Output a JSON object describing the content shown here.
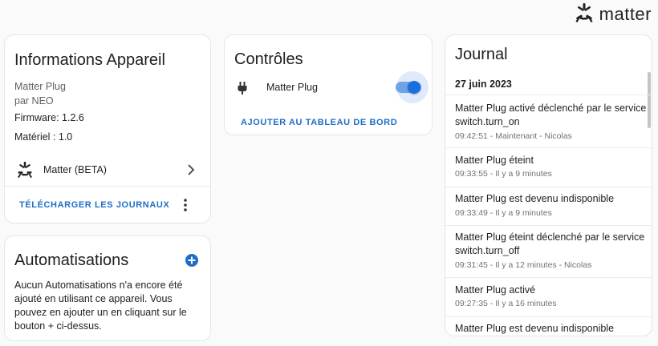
{
  "brand": {
    "name": "matter"
  },
  "info_card": {
    "title": "Informations Appareil",
    "device_name": "Matter Plug",
    "manufacturer": "par NEO",
    "firmware": "Firmware: 1.2.6",
    "hardware": "Matériel : 1.0",
    "integration_label": "Matter (BETA)",
    "download_logs": "TÉLÉCHARGER LES JOURNAUX"
  },
  "automations_card": {
    "title": "Automatisations",
    "empty_text": "Aucun Automatisations n'a encore été ajouté en utilisant ce appareil. Vous pouvez en ajouter un en cliquant sur le bouton + ci-dessus."
  },
  "controls_card": {
    "title": "Contrôles",
    "entity_name": "Matter Plug",
    "toggle_on": true,
    "add_to_dashboard": "AJOUTER AU TABLEAU DE BORD"
  },
  "journal_card": {
    "title": "Journal",
    "date": "27 juin 2023",
    "entries": [
      {
        "line1": "Matter Plug activé déclenché par le service",
        "line2": "switch.turn_on",
        "meta": "09:42:51 - Maintenant - Nicolas"
      },
      {
        "line1": "Matter Plug éteint",
        "line2": "",
        "meta": "09:33:55 - Il y a 9 minutes"
      },
      {
        "line1": "Matter Plug est devenu indisponible",
        "line2": "",
        "meta": "09:33:49 - Il y a 9 minutes"
      },
      {
        "line1": "Matter Plug éteint déclenché par le service",
        "line2": "switch.turn_off",
        "meta": "09:31:45 - Il y a 12 minutes - Nicolas"
      },
      {
        "line1": "Matter Plug activé",
        "line2": "",
        "meta": "09:27:35 - Il y a 16 minutes"
      },
      {
        "line1": "Matter Plug est devenu indisponible",
        "line2": "",
        "meta": ""
      }
    ]
  },
  "colors": {
    "accent": "#1e6ec8",
    "toggle": "#1a6fe0"
  },
  "icons": {
    "brand": "matter-logo-icon",
    "plug": "plug-icon",
    "integration": "matter-logo-icon",
    "chevron": "chevron-right-icon",
    "more": "more-vertical-icon",
    "add": "plus-circle-icon"
  }
}
